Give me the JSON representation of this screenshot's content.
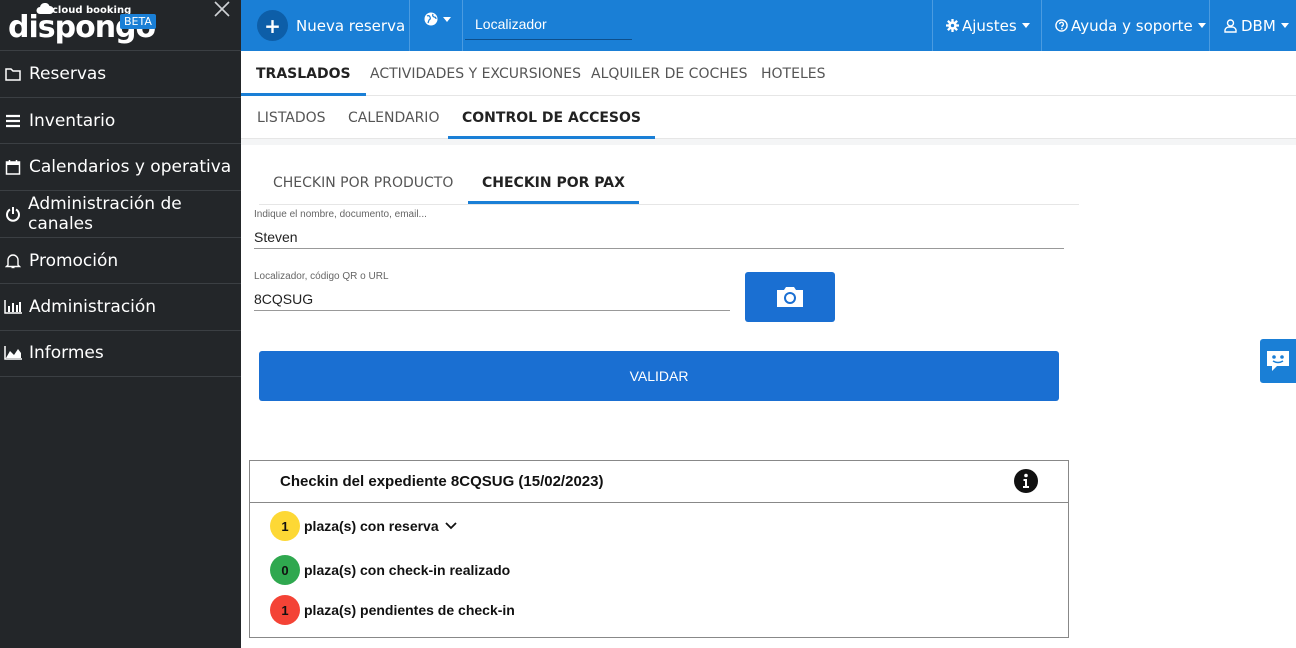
{
  "brand": {
    "small": "cloud booking",
    "name": "dispongo",
    "badge": "BETA"
  },
  "sidebar": {
    "items": [
      {
        "label": "Reservas",
        "icon": "folder-icon"
      },
      {
        "label": "Inventario",
        "icon": "list-icon"
      },
      {
        "label": "Calendarios y operativa",
        "icon": "calendar-icon"
      },
      {
        "label": "Administración de canales",
        "icon": "power-icon"
      },
      {
        "label": "Promoción",
        "icon": "bell-icon"
      },
      {
        "label": "Administración",
        "icon": "bar-chart-icon"
      },
      {
        "label": "Informes",
        "icon": "area-chart-icon"
      }
    ]
  },
  "topbar": {
    "new_booking": "Nueva reserva",
    "search_placeholder": "Localizador",
    "settings": "Ajustes",
    "help": "Ayuda y soporte",
    "user": "DBM"
  },
  "tabs_main": [
    "TRASLADOS",
    "ACTIVIDADES Y EXCURSIONES",
    "ALQUILER DE COCHES",
    "HOTELES"
  ],
  "tabs_sub": [
    "LISTADOS",
    "CALENDARIO",
    "CONTROL DE ACCESOS"
  ],
  "tabs_checkin": [
    "CHECKIN POR PRODUCTO",
    "CHECKIN POR PAX"
  ],
  "form": {
    "name_label": "Indique el nombre, documento, email...",
    "name_value": "Steven",
    "locator_label": "Localizador, código QR o URL",
    "locator_value": "8CQSUG",
    "validate": "VALIDAR"
  },
  "checkin": {
    "title": "Checkin del expediente 8CQSUG (15/02/2023)",
    "stats": [
      {
        "count": "1",
        "label": "plaza(s) con reserva",
        "color": "#fdd835"
      },
      {
        "count": "0",
        "label": "plaza(s) con check-in realizado",
        "color": "#2fa84f"
      },
      {
        "count": "1",
        "label": "plaza(s) pendientes de check-in",
        "color": "#f44336"
      }
    ]
  },
  "colors": {
    "primary": "#1a7fd6",
    "sidebar": "#232629"
  }
}
